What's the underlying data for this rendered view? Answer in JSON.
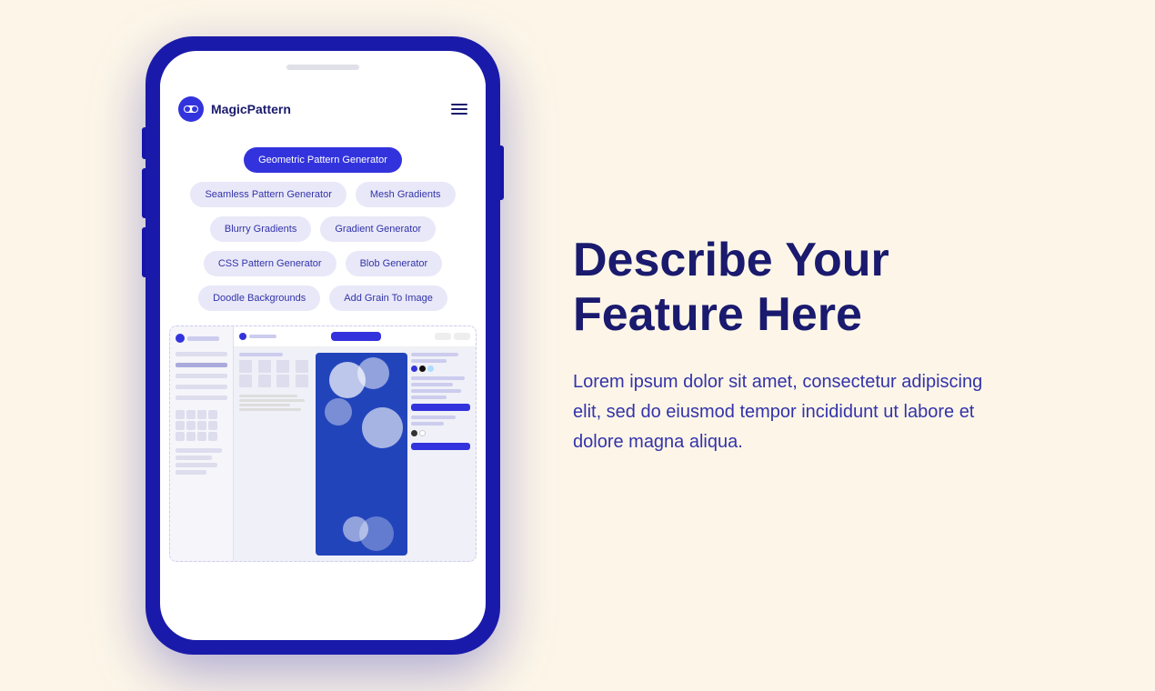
{
  "page": {
    "background": "#fdf6e8"
  },
  "phone": {
    "logo_text": "MagicPattern",
    "nav_pills": [
      {
        "label": "Geometric Pattern Generator",
        "active": true
      },
      {
        "label": "Seamless Pattern Generator",
        "active": false
      },
      {
        "label": "Mesh Gradients",
        "active": false
      },
      {
        "label": "Blurry Gradients",
        "active": false
      },
      {
        "label": "Gradient Generator",
        "active": false
      },
      {
        "label": "CSS Pattern Generator",
        "active": false
      },
      {
        "label": "Blob Generator",
        "active": false
      },
      {
        "label": "Doodle Backgrounds",
        "active": false
      },
      {
        "label": "Add Grain To Image",
        "active": false
      }
    ]
  },
  "content": {
    "headline_line1": "Describe Your",
    "headline_line2": "Feature Here",
    "description": "Lorem ipsum dolor sit amet, consectetur adipiscing elit, sed do eiusmod tempor incididunt ut labore et dolore magna aliqua."
  }
}
